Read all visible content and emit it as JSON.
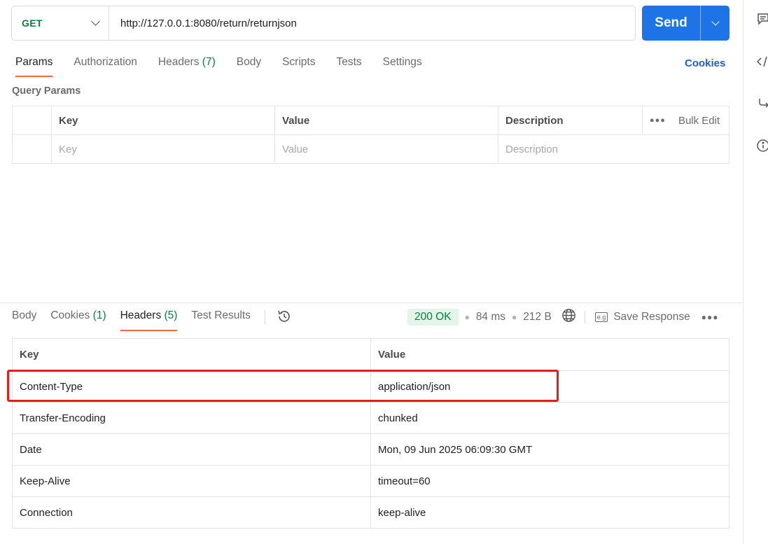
{
  "request": {
    "method": "GET",
    "url": "http://127.0.0.1:8080/return/returnjson",
    "send_label": "Send"
  },
  "request_tabs": [
    {
      "label": "Params",
      "count": "",
      "active": true
    },
    {
      "label": "Authorization",
      "count": ""
    },
    {
      "label": "Headers",
      "count": "(7)"
    },
    {
      "label": "Body",
      "count": ""
    },
    {
      "label": "Scripts",
      "count": ""
    },
    {
      "label": "Tests",
      "count": ""
    },
    {
      "label": "Settings",
      "count": ""
    }
  ],
  "cookies_link": "Cookies",
  "query_params": {
    "title": "Query Params",
    "columns": [
      "Key",
      "Value",
      "Description"
    ],
    "bulk_edit": "Bulk Edit",
    "placeholders": [
      "Key",
      "Value",
      "Description"
    ]
  },
  "response_tabs": [
    {
      "label": "Body",
      "count": ""
    },
    {
      "label": "Cookies",
      "count": "(1)"
    },
    {
      "label": "Headers",
      "count": "(5)",
      "active": true
    },
    {
      "label": "Test Results",
      "count": ""
    }
  ],
  "response_meta": {
    "status": "200 OK",
    "time": "84 ms",
    "size": "212 B",
    "save_label": "Save Response",
    "eg_label": "e.g"
  },
  "response_headers": {
    "columns": [
      "Key",
      "Value"
    ],
    "rows": [
      [
        "Content-Type",
        "application/json"
      ],
      [
        "Transfer-Encoding",
        "chunked"
      ],
      [
        "Date",
        "Mon, 09 Jun 2025 06:09:30 GMT"
      ],
      [
        "Keep-Alive",
        "timeout=60"
      ],
      [
        "Connection",
        "keep-alive"
      ]
    ]
  },
  "colors": {
    "method": "#0a7e3f",
    "send": "#1e74e6",
    "active_tab_underline": "#f26b3a",
    "highlight_box": "#e0201c",
    "status_bg": "#e3f5e8"
  },
  "icons": [
    "chevron-down-icon",
    "history-icon",
    "globe-icon",
    "more-icon",
    "comment-icon",
    "code-icon",
    "related-icon",
    "info-icon"
  ]
}
